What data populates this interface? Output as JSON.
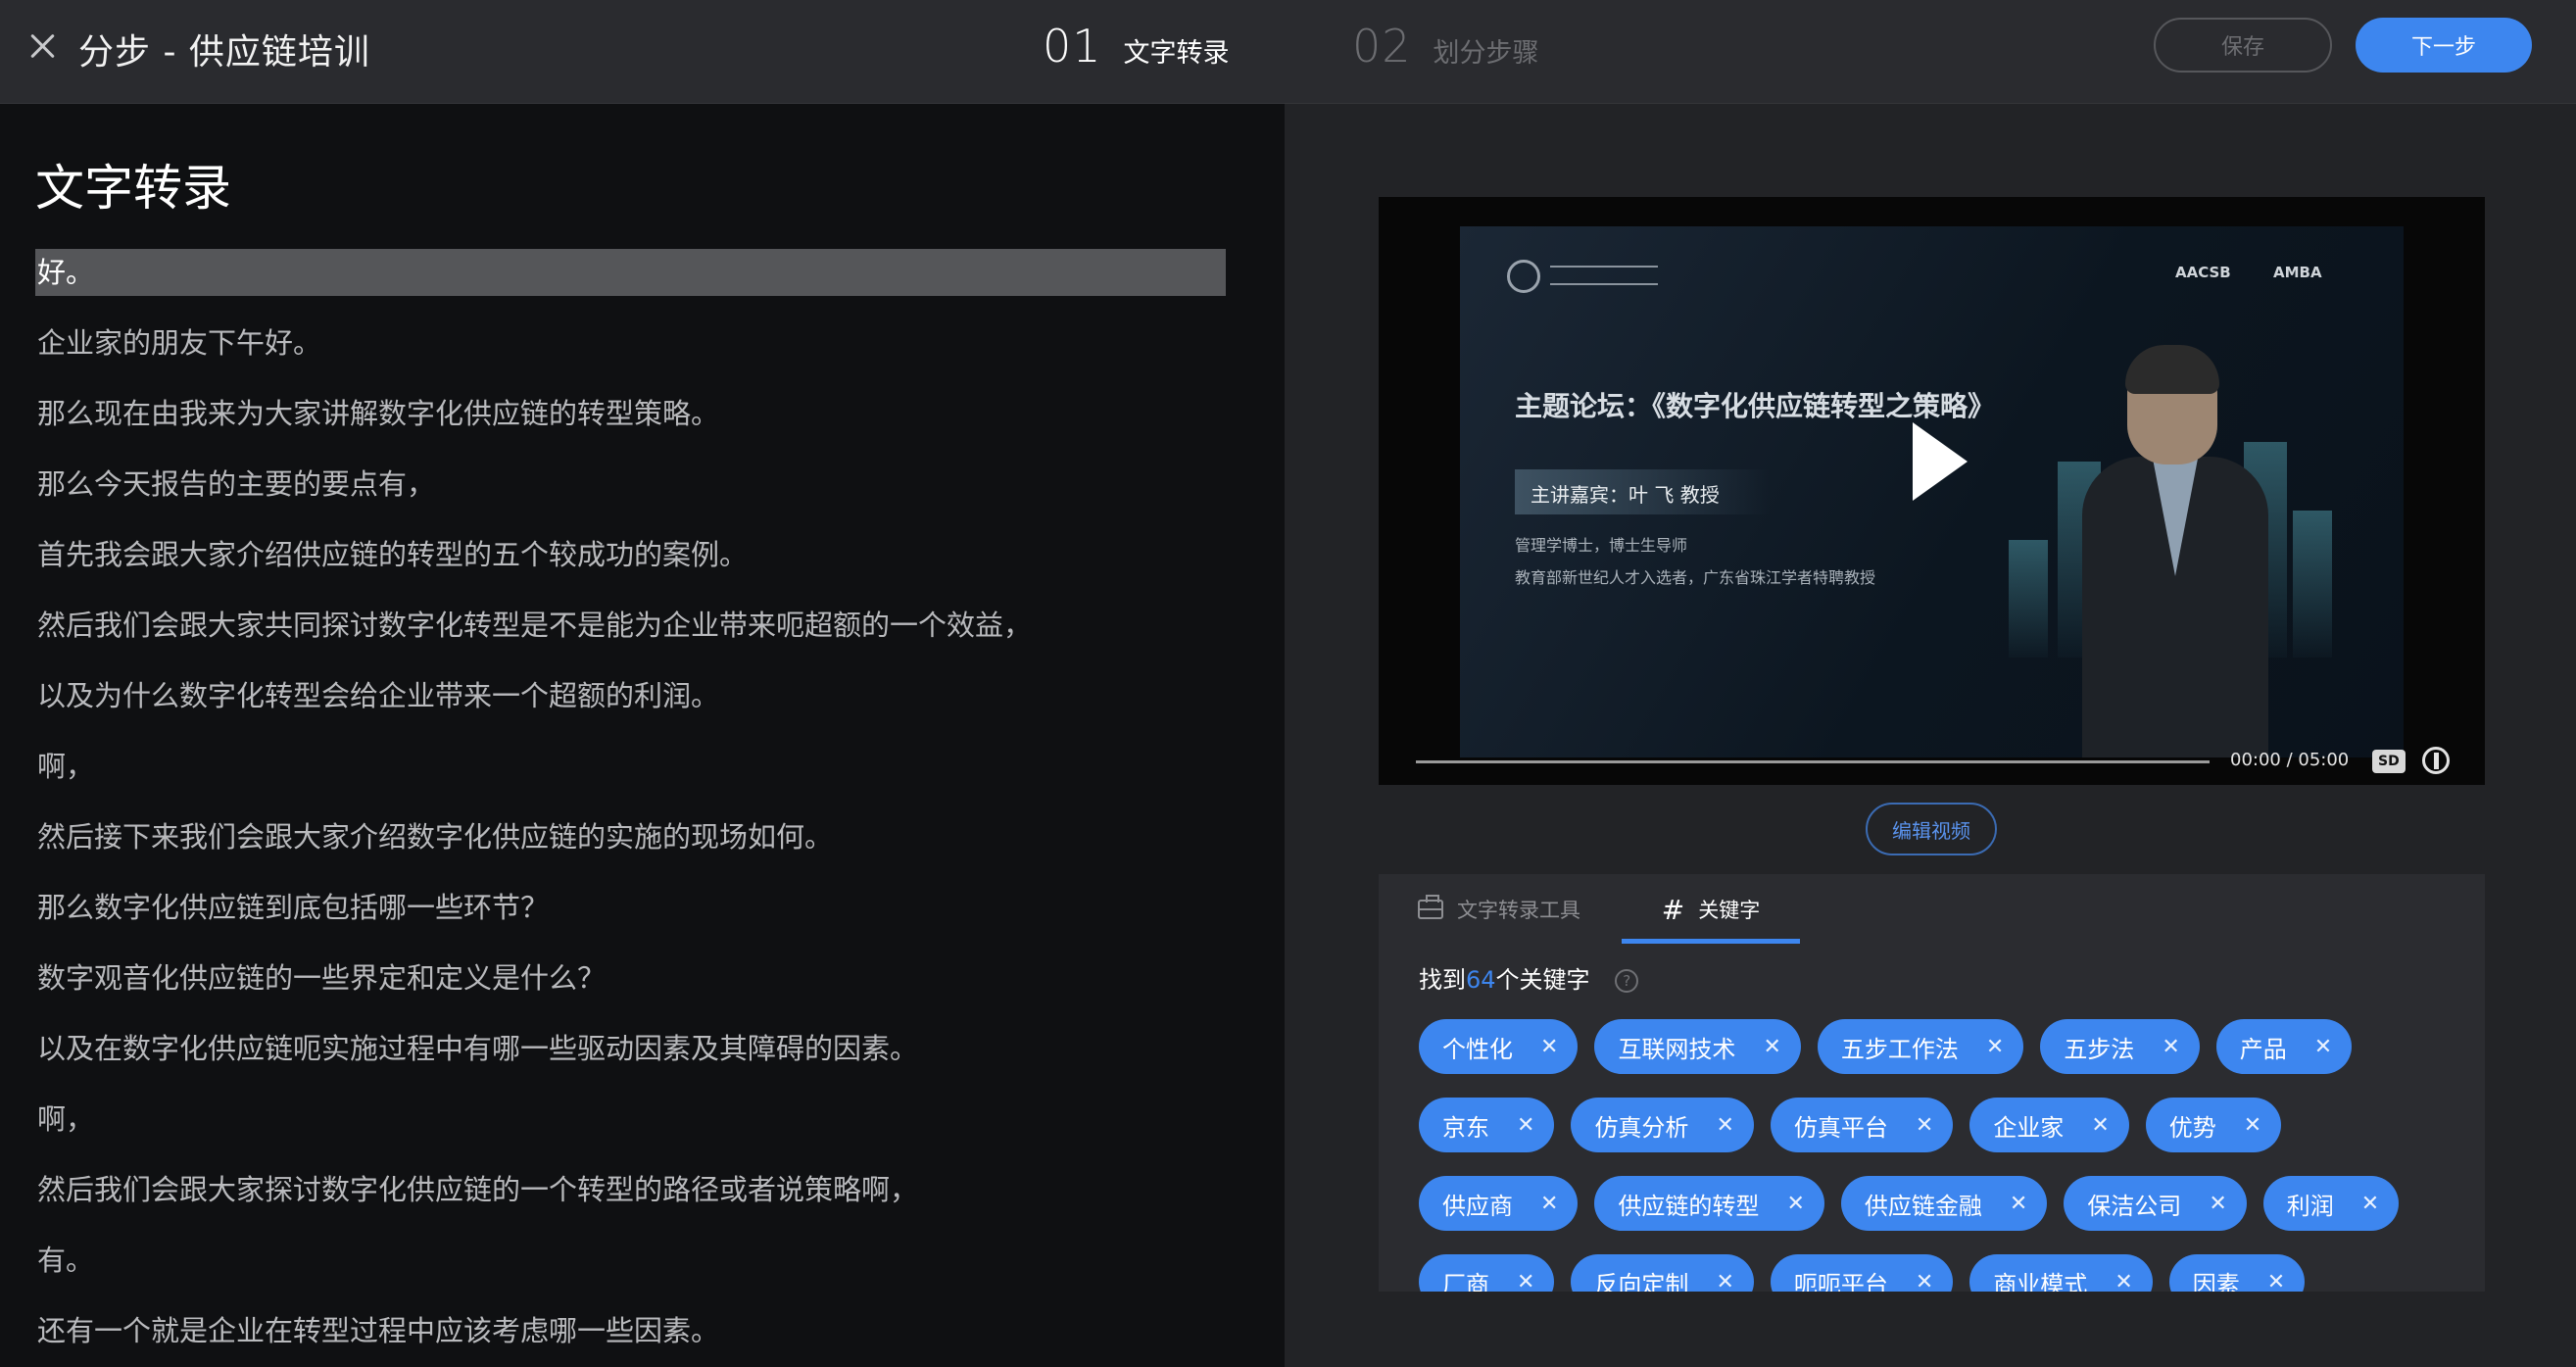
{
  "header": {
    "title": "分步 - 供应链培训",
    "step1": {
      "num": "01",
      "label": "文字转录"
    },
    "step2": {
      "num": "02",
      "label": "划分步骤"
    },
    "save_label": "保存",
    "next_label": "下一步"
  },
  "transcript": {
    "title": "文字转录",
    "lines": [
      "好。",
      "企业家的朋友下午好。",
      "那么现在由我来为大家讲解数字化供应链的转型策略。",
      "那么今天报告的主要的要点有，",
      "首先我会跟大家介绍供应链的转型的五个较成功的案例。",
      "然后我们会跟大家共同探讨数字化转型是不是能为企业带来呃超额的一个效益，",
      "以及为什么数字化转型会给企业带来一个超额的利润。",
      "啊，",
      "然后接下来我们会跟大家介绍数字化供应链的实施的现场如何。",
      "那么数字化供应链到底包括哪一些环节？",
      "数字观音化供应链的一些界定和定义是什么？",
      "以及在数字化供应链呃实施过程中有哪一些驱动因素及其障碍的因素。",
      "啊，",
      "然后我们会跟大家探讨数字化供应链的一个转型的路径或者说策略啊，",
      "有。",
      "还有一个就是企业在转型过程中应该考虑哪一些因素。"
    ]
  },
  "video": {
    "slide_title": "主题论坛：《数字化供应链转型之策略》",
    "speaker": "主讲嘉宾：叶 飞 教授",
    "desc1": "管理学博士，博士生导师",
    "desc2": "教育部新世纪人才入选者，广东省珠江学者特聘教授",
    "logo1": "AACSB",
    "logo2": "AMBA",
    "time": "00:00  /  05:00",
    "quality": "SD",
    "edit_label": "编辑视频",
    "progress_fraction": 0.0
  },
  "keywords": {
    "tab_tools": "文字转录工具",
    "tab_keywords": "关键字",
    "found_prefix": "找到",
    "found_count": "64",
    "found_suffix": "个关键字",
    "help": "?",
    "rows": [
      [
        "个性化",
        "互联网技术",
        "五步工作法",
        "五步法",
        "产品"
      ],
      [
        "京东",
        "仿真分析",
        "仿真平台",
        "企业家",
        "优势"
      ],
      [
        "供应商",
        "供应链的转型",
        "供应链金融",
        "保洁公司",
        "利润"
      ],
      [
        "厂商",
        "反向定制",
        "呃呃平台",
        "商业模式",
        "因素"
      ]
    ]
  }
}
